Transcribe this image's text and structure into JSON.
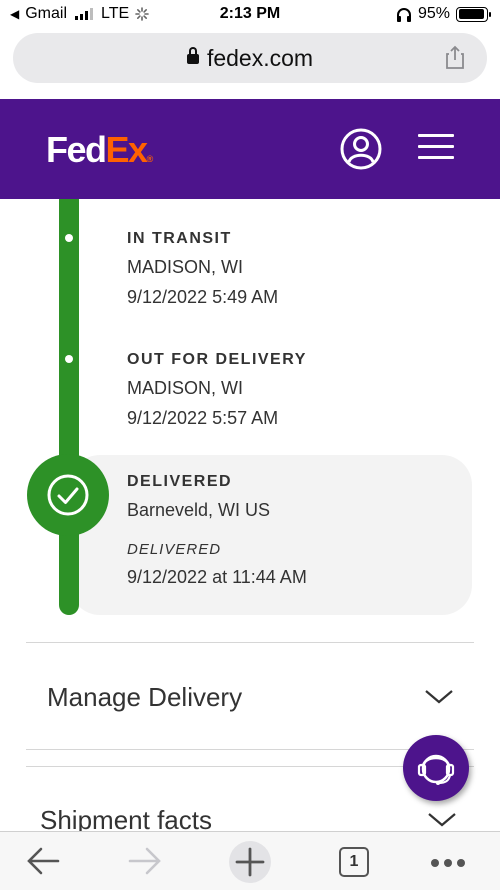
{
  "status_bar": {
    "back_app": "Gmail",
    "carrier": "LTE",
    "time": "2:13 PM",
    "battery": "95%"
  },
  "browser": {
    "url": "fedex.com"
  },
  "header": {
    "logo_fed": "Fed",
    "logo_ex": "Ex",
    "logo_reg": "®",
    "icons": [
      "user-icon",
      "menu-icon"
    ]
  },
  "timeline": {
    "events": [
      {
        "status": "IN TRANSIT",
        "location": "MADISON, WI",
        "datetime": "9/12/2022 5:49 AM"
      },
      {
        "status": "OUT FOR DELIVERY",
        "location": "MADISON, WI",
        "datetime": "9/12/2022 5:57 AM"
      }
    ],
    "delivered": {
      "status": "DELIVERED",
      "location": "Barneveld, WI US",
      "sub_status": "DELIVERED",
      "datetime": "9/12/2022 at 11:44 AM"
    }
  },
  "sections": {
    "manage_delivery": "Manage Delivery",
    "shipment_facts": "Shipment facts"
  },
  "toolbar": {
    "tabs_count": "1"
  },
  "colors": {
    "fedex_purple": "#4d148c",
    "fedex_orange": "#ff6200",
    "timeline_green": "#2d9127"
  }
}
